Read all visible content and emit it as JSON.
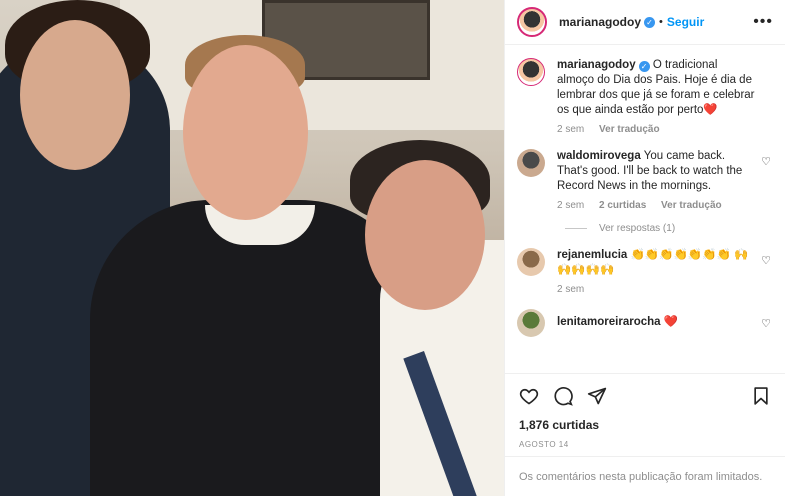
{
  "post": {
    "author": "marianagodoy",
    "follow_label": "Seguir",
    "more_label": "•••"
  },
  "caption": {
    "username": "marianagodoy",
    "text": "O tradicional almoço do Dia dos Pais. Hoje é dia de lembrar dos que já se foram e celebrar os que ainda estão por perto",
    "emoji": "❤️",
    "time": "2 sem",
    "translate": "Ver tradução"
  },
  "comments": [
    {
      "username": "waldomirovega",
      "text": "You came back. That's good. I'll be back to watch the Record News in the mornings.",
      "time": "2 sem",
      "likes": "2 curtidas",
      "translate": "Ver tradução",
      "replies": "Ver respostas (1)"
    },
    {
      "username": "rejanemlucia",
      "text": "👏👏👏👏👏👏👏 🙌🙌🙌🙌🙌",
      "time": "2 sem"
    },
    {
      "username": "lenitamoreirarocha",
      "text": "❤️"
    }
  ],
  "stats": {
    "likes": "1,876 curtidas",
    "date": "AGOSTO 14"
  },
  "footer": {
    "limited_text": "Os comentários nesta publicação foram limitados."
  },
  "colors": {
    "link_blue": "#0095f6",
    "verified_blue": "#3897f0",
    "meta_gray": "#8e8e8e",
    "heart_red": "#ed4956"
  }
}
